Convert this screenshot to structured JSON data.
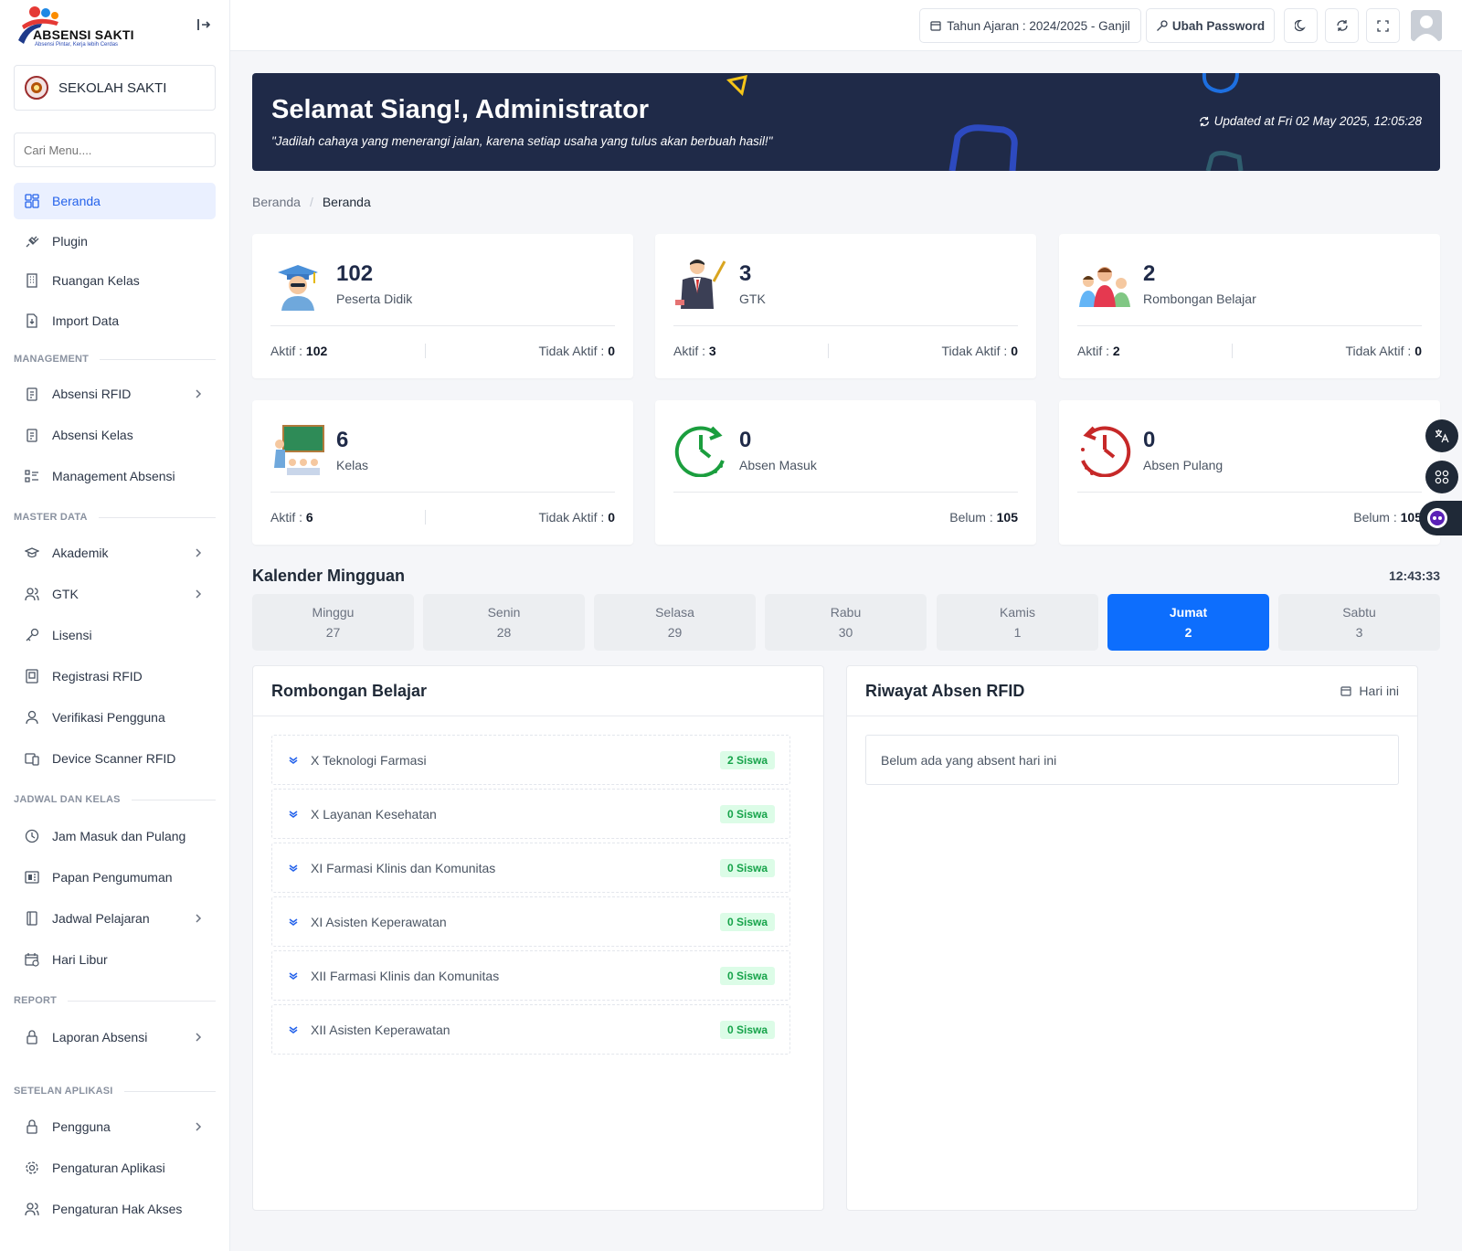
{
  "app": {
    "logo_text": "ABSENSI SAKTI",
    "logo_tagline": "Absensi Pintar, Kerja lebih Cerdas",
    "school_name": "SEKOLAH SAKTI",
    "search_placeholder": "Cari Menu...."
  },
  "sidebar": {
    "top_items": [
      {
        "label": "Beranda",
        "icon": "dashboard-icon",
        "active": true
      },
      {
        "label": "Plugin",
        "icon": "plug-icon"
      },
      {
        "label": "Ruangan Kelas",
        "icon": "building-icon"
      },
      {
        "label": "Import Data",
        "icon": "file-import-icon"
      }
    ],
    "sections": [
      {
        "title": "MANAGEMENT",
        "items": [
          {
            "label": "Absensi RFID",
            "icon": "clipboard-icon",
            "has_children": true
          },
          {
            "label": "Absensi Kelas",
            "icon": "clipboard-icon"
          },
          {
            "label": "Management Absensi",
            "icon": "list-icon"
          }
        ]
      },
      {
        "title": "MASTER DATA",
        "items": [
          {
            "label": "Akademik",
            "icon": "graduation-cap-icon",
            "has_children": true
          },
          {
            "label": "GTK",
            "icon": "users-icon",
            "has_children": true
          },
          {
            "label": "Lisensi",
            "icon": "key-icon"
          },
          {
            "label": "Registrasi RFID",
            "icon": "card-icon"
          },
          {
            "label": "Verifikasi Pengguna",
            "icon": "user-icon"
          },
          {
            "label": "Device Scanner RFID",
            "icon": "devices-icon"
          }
        ]
      },
      {
        "title": "JADWAL DAN KELAS",
        "items": [
          {
            "label": "Jam Masuk dan Pulang",
            "icon": "clock-icon"
          },
          {
            "label": "Papan Pengumuman",
            "icon": "board-icon"
          },
          {
            "label": "Jadwal Pelajaran",
            "icon": "book-icon",
            "has_children": true
          },
          {
            "label": "Hari Libur",
            "icon": "calendar-icon"
          }
        ]
      },
      {
        "title": "REPORT",
        "items": [
          {
            "label": "Laporan Absensi",
            "icon": "lock-icon",
            "has_children": true
          }
        ]
      },
      {
        "title": "SETELAN APLIKASI",
        "items": [
          {
            "label": "Pengguna",
            "icon": "lock-icon",
            "has_children": true
          },
          {
            "label": "Pengaturan Aplikasi",
            "icon": "gear-icon"
          },
          {
            "label": "Pengaturan Hak Akses",
            "icon": "users-icon"
          }
        ]
      }
    ]
  },
  "header": {
    "academic_year": "Tahun Ajaran : 2024/2025 - Ganjil",
    "change_password": "Ubah Password"
  },
  "banner": {
    "greeting": "Selamat Siang!, Administrator",
    "quote": "\"Jadilah cahaya yang menerangi jalan, karena setiap usaha yang tulus akan berbuah hasil!\"",
    "updated": "Updated at Fri 02 May 2025, 12:05:28"
  },
  "breadcrumb": {
    "parent": "Beranda",
    "current": "Beranda"
  },
  "stats": [
    {
      "value": "102",
      "label": "Peserta Didik",
      "aktif_label": "Aktif : ",
      "aktif": "102",
      "tidak_label": "Tidak Aktif : ",
      "tidak": "0"
    },
    {
      "value": "3",
      "label": "GTK",
      "aktif_label": "Aktif : ",
      "aktif": "3",
      "tidak_label": "Tidak Aktif : ",
      "tidak": "0"
    },
    {
      "value": "2",
      "label": "Rombongan Belajar",
      "aktif_label": "Aktif : ",
      "aktif": "2",
      "tidak_label": "Tidak Aktif : ",
      "tidak": "0"
    },
    {
      "value": "6",
      "label": "Kelas",
      "aktif_label": "Aktif : ",
      "aktif": "6",
      "tidak_label": "Tidak Aktif : ",
      "tidak": "0"
    },
    {
      "value": "0",
      "label": "Absen Masuk",
      "belum_label": "Belum : ",
      "belum": "105"
    },
    {
      "value": "0",
      "label": "Absen Pulang",
      "belum_label": "Belum : ",
      "belum": "105"
    }
  ],
  "weekly": {
    "title": "Kalender Mingguan",
    "clock": "12:43:33",
    "days": [
      {
        "name": "Minggu",
        "date": "27"
      },
      {
        "name": "Senin",
        "date": "28"
      },
      {
        "name": "Selasa",
        "date": "29"
      },
      {
        "name": "Rabu",
        "date": "30"
      },
      {
        "name": "Kamis",
        "date": "1"
      },
      {
        "name": "Jumat",
        "date": "2",
        "today": true
      },
      {
        "name": "Sabtu",
        "date": "3"
      }
    ]
  },
  "rombel": {
    "title": "Rombongan Belajar",
    "items": [
      {
        "name": "X Teknologi Farmasi",
        "count": "2 Siswa"
      },
      {
        "name": "X Layanan Kesehatan",
        "count": "0 Siswa"
      },
      {
        "name": "XI Farmasi Klinis dan Komunitas",
        "count": "0 Siswa"
      },
      {
        "name": "XI Asisten Keperawatan",
        "count": "0 Siswa"
      },
      {
        "name": "XII Farmasi Klinis dan Komunitas",
        "count": "0 Siswa"
      },
      {
        "name": "XII Asisten Keperawatan",
        "count": "0 Siswa"
      }
    ]
  },
  "riwayat": {
    "title": "Riwayat Absen RFID",
    "filter": "Hari ini",
    "empty": "Belum ada yang absent hari ini"
  }
}
